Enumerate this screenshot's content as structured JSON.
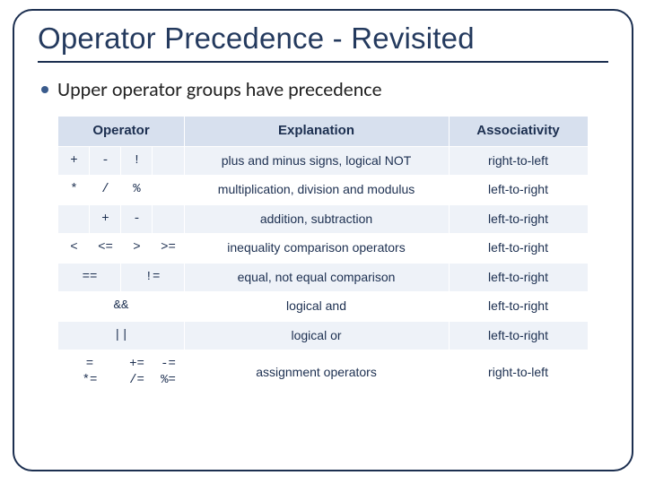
{
  "title": "Operator Precedence - Revisited",
  "bullet": "Upper operator groups have precedence",
  "headers": {
    "operator": "Operator",
    "explanation": "Explanation",
    "associativity": "Associativity"
  },
  "rows": [
    {
      "ops": [
        "+",
        "-",
        "!",
        ""
      ],
      "explanation": "plus and minus signs, logical NOT",
      "assoc": "right-to-left"
    },
    {
      "ops": [
        "*",
        "/",
        "%",
        ""
      ],
      "explanation": "multiplication, division and modulus",
      "assoc": "left-to-right"
    },
    {
      "ops": [
        "",
        "+",
        "-",
        ""
      ],
      "explanation": "addition, subtraction",
      "assoc": "left-to-right"
    },
    {
      "ops": [
        "<",
        "<=",
        ">",
        ">="
      ],
      "explanation": "inequality comparison operators",
      "assoc": "left-to-right"
    },
    {
      "ops_merged": [
        {
          "text": "==",
          "span": 2
        },
        {
          "text": "!=",
          "span": 2
        }
      ],
      "explanation": "equal,  not equal comparison",
      "assoc": "left-to-right"
    },
    {
      "ops_full": "&&",
      "explanation": "logical and",
      "assoc": "left-to-right"
    },
    {
      "ops_full": "||",
      "explanation": "logical or",
      "assoc": "left-to-right"
    },
    {
      "ops_merged": [
        {
          "text": "=\n*=",
          "span": 2
        },
        {
          "text": "+=\n/=",
          "span": 1
        },
        {
          "text": "-=\n%=",
          "span": 1
        }
      ],
      "explanation": "assignment operators",
      "assoc": "right-to-left"
    }
  ],
  "chart_data": {
    "type": "table",
    "title": "Operator Precedence - Revisited",
    "columns": [
      "Operator",
      "Explanation",
      "Associativity"
    ],
    "rows": [
      [
        "+  -  !",
        "plus and minus signs, logical NOT",
        "right-to-left"
      ],
      [
        "*  /  %",
        "multiplication, division and modulus",
        "left-to-right"
      ],
      [
        "+  -",
        "addition, subtraction",
        "left-to-right"
      ],
      [
        "<  <=  >  >=",
        "inequality comparison operators",
        "left-to-right"
      ],
      [
        "==  !=",
        "equal, not equal comparison",
        "left-to-right"
      ],
      [
        "&&",
        "logical and",
        "left-to-right"
      ],
      [
        "||",
        "logical or",
        "left-to-right"
      ],
      [
        "=  +=  -=  *=  /=  %=",
        "assignment operators",
        "right-to-left"
      ]
    ]
  }
}
